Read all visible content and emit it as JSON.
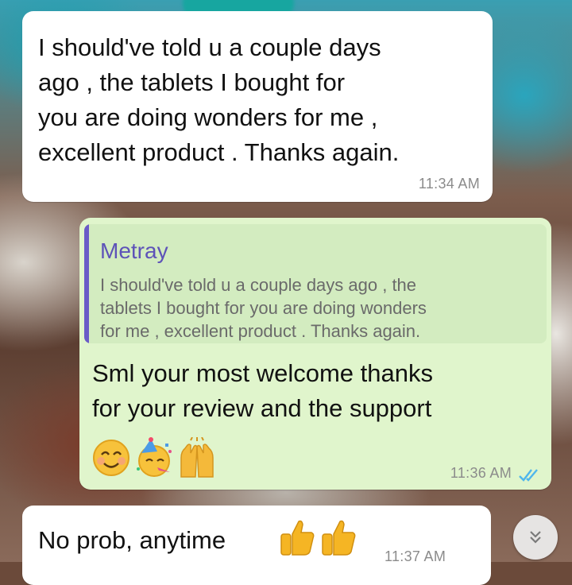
{
  "messages": [
    {
      "direction": "incoming",
      "text": "I should've told u a couple days\nago , the tablets I bought for\nyou  are doing wonders for me ,\nexcellent product . Thanks again.",
      "time": "11:34 AM"
    },
    {
      "direction": "outgoing",
      "quote": {
        "author": "Metray",
        "text": "I should've told u a couple days ago , the\ntablets I bought for you  are doing wonders\nfor me , excellent product . Thanks again."
      },
      "text": "Sml your most welcome thanks\nfor your review and the support",
      "emojis": [
        "smiling-face-icon",
        "partying-face-icon",
        "raising-hands-icon"
      ],
      "time": "11:36 AM",
      "status": "read-double-check-icon"
    },
    {
      "direction": "incoming",
      "text": "No prob, anytime",
      "emojis": [
        "thumbs-up-icon",
        "thumbs-up-icon"
      ],
      "time": "11:37 AM"
    }
  ],
  "scroll_button": {
    "icon": "double-chevron-down-icon"
  },
  "colors": {
    "incoming_bubble": "#ffffff",
    "outgoing_bubble": "#e0f5cc",
    "quote_author": "#5d52b8",
    "quote_bar": "#6a5bc7",
    "read_ticks": "#4fb6ec"
  }
}
